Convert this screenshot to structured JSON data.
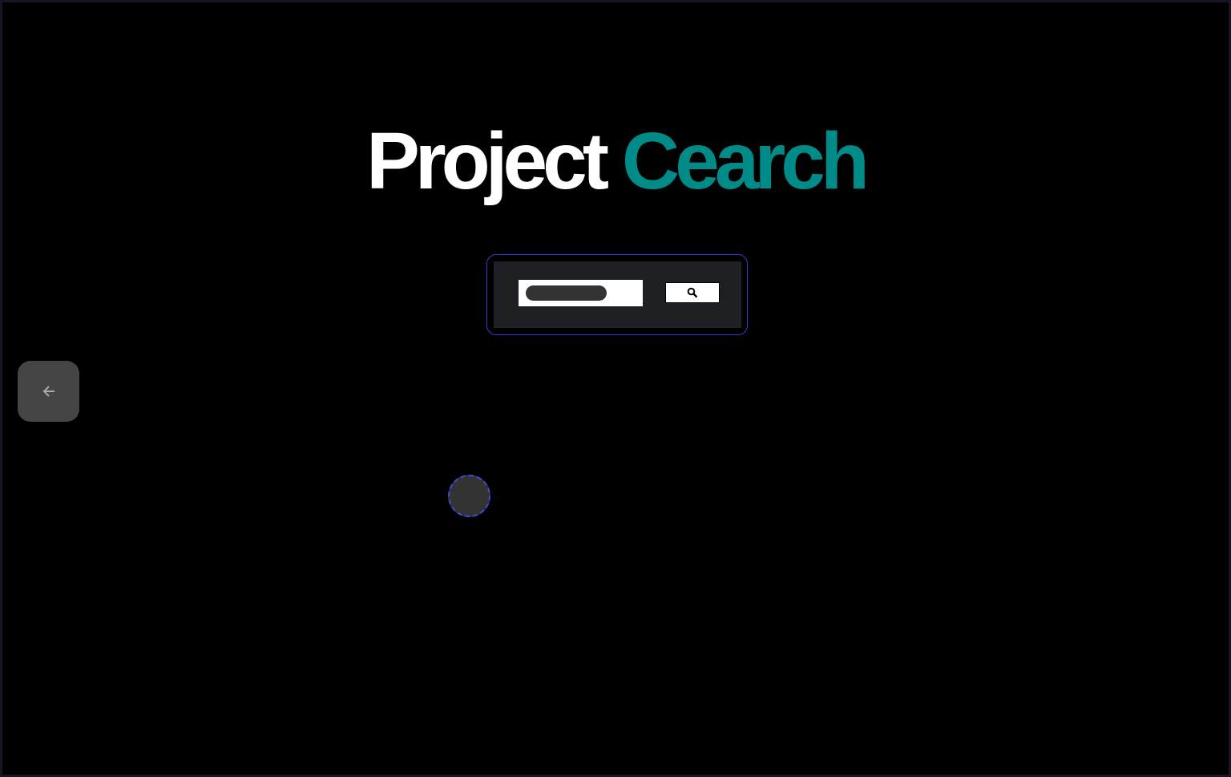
{
  "title": {
    "part1": "Project",
    "part2": "Cearch"
  },
  "colors": {
    "accent": "#008b88",
    "focus_border": "#3b3bd6"
  },
  "search": {
    "value": "",
    "button_icon": "search-icon"
  },
  "nav": {
    "back_icon": "arrow-left-icon"
  }
}
